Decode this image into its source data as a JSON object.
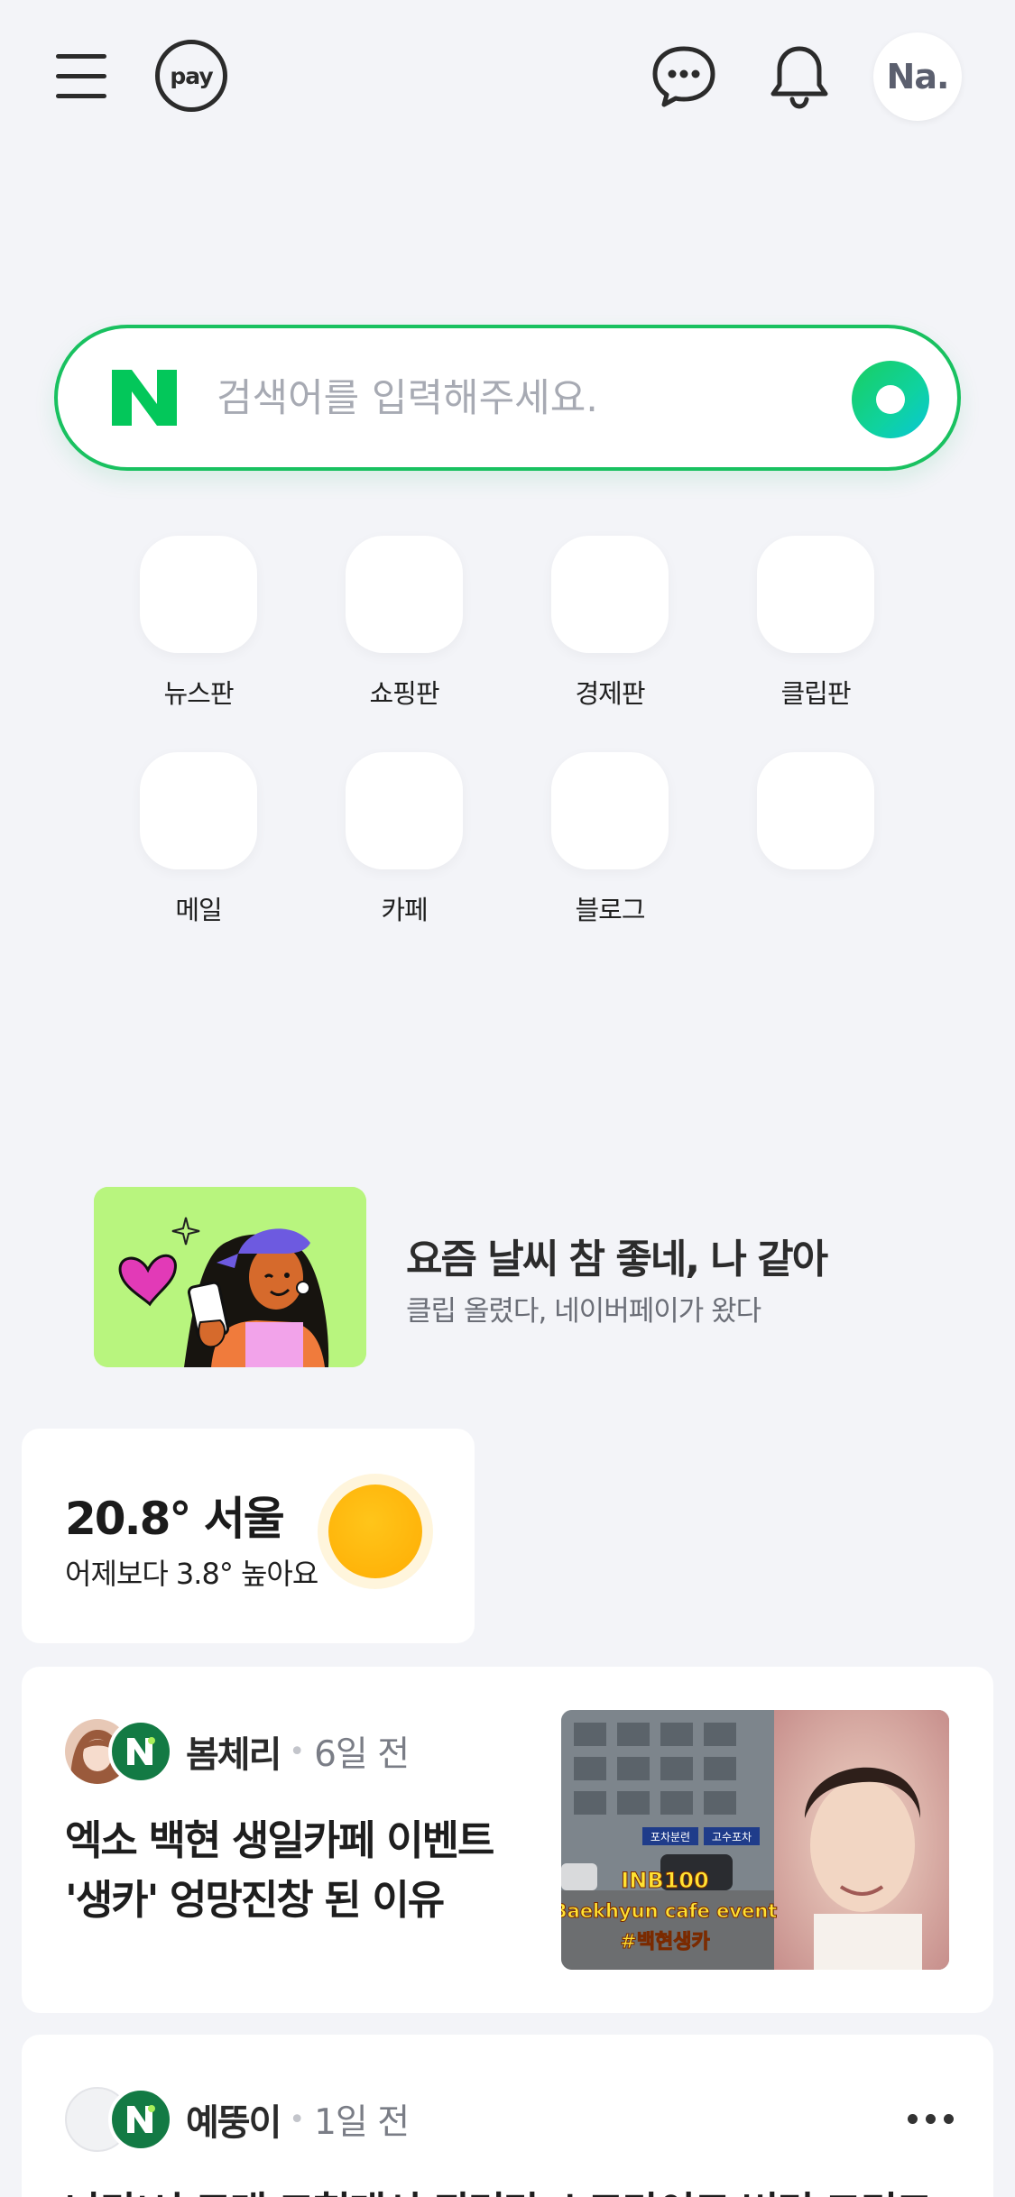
{
  "topbar": {
    "menu_icon": "hamburger-menu-icon",
    "pay_label": "pay",
    "chat_icon": "chat-bubble-icon",
    "bell_icon": "bell-icon",
    "avatar_text": "Na."
  },
  "search": {
    "placeholder": "검색어를 입력해주세요.",
    "logo_letter": "N",
    "green_button_icon": "green-dot-icon"
  },
  "shortcuts": [
    {
      "label": "뉴스판"
    },
    {
      "label": "쇼핑판"
    },
    {
      "label": "경제판"
    },
    {
      "label": "클립판"
    },
    {
      "label": "메일"
    },
    {
      "label": "카페"
    },
    {
      "label": "블로그"
    },
    {
      "label": ""
    }
  ],
  "promo": {
    "title": "요즘 날씨 참 좋네, 나 같아",
    "subtitle": "클립 올렸다, 네이버페이가 왔다"
  },
  "weather": {
    "temperature": "20.8°",
    "city": "서울",
    "description": "어제보다 3.8° 높아요",
    "icon": "sun-icon"
  },
  "feed": [
    {
      "author": "봄체리",
      "time": "6일 전",
      "headline_lines": [
        "엑소 백현 생일카페 이벤트",
        "'생카' 엉망진창 된 이유"
      ],
      "thumbnail_text": [
        "INB100",
        "Baekhyun cafe event",
        "#백현생카"
      ],
      "thumbnail_signs": [
        "포차분련",
        "고수포차"
      ]
    },
    {
      "author": "예뚱이",
      "time": "1일 전",
      "headline_partial": "나라'시 코래 그헌대서 되더라 스트라이트 버리 그리그"
    }
  ]
}
